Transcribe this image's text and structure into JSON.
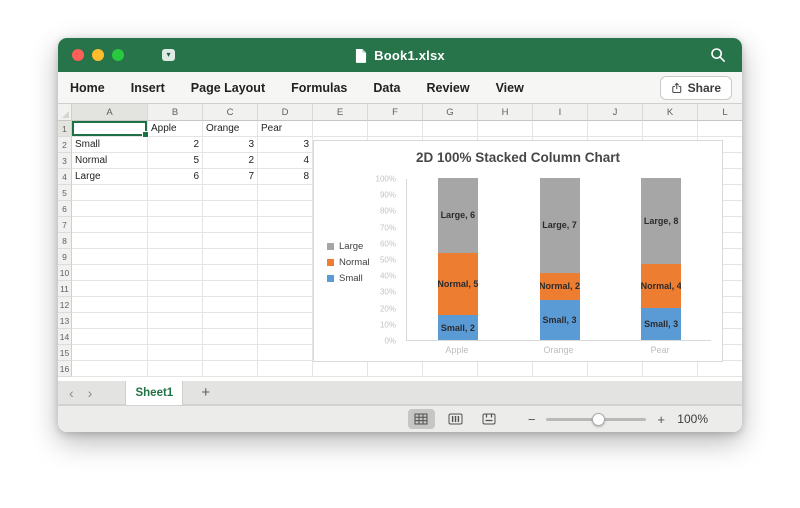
{
  "window": {
    "title": "Book1.xlsx",
    "controls": {
      "close": "close",
      "minimize": "minimize",
      "zoom": "zoom"
    }
  },
  "ribbon": {
    "tabs": [
      "Home",
      "Insert",
      "Page Layout",
      "Formulas",
      "Data",
      "Review",
      "View"
    ],
    "share_label": "Share"
  },
  "spreadsheet": {
    "columns": [
      "A",
      "B",
      "C",
      "D",
      "E",
      "F",
      "G",
      "H",
      "I",
      "J",
      "K",
      "L"
    ],
    "row_count": 16,
    "selected_cell": "A1",
    "data_rows": [
      [
        "",
        "Apple",
        "Orange",
        "Pear"
      ],
      [
        "Small",
        2,
        3,
        3
      ],
      [
        "Normal",
        5,
        2,
        4
      ],
      [
        "Large",
        6,
        7,
        8
      ]
    ]
  },
  "chart_data": {
    "type": "bar",
    "subtype": "100%-stacked-column",
    "title": "2D 100% Stacked Column Chart",
    "categories": [
      "Apple",
      "Orange",
      "Pear"
    ],
    "series": [
      {
        "name": "Small",
        "color": "#5b9bd5",
        "values": [
          2,
          3,
          3
        ]
      },
      {
        "name": "Normal",
        "color": "#ed7d31",
        "values": [
          5,
          2,
          4
        ]
      },
      {
        "name": "Large",
        "color": "#a6a6a6",
        "values": [
          6,
          7,
          8
        ]
      }
    ],
    "legend_order": [
      "Large",
      "Normal",
      "Small"
    ],
    "legend_position": "left",
    "y_ticks": [
      "100%",
      "90%",
      "80%",
      "70%",
      "60%",
      "50%",
      "40%",
      "30%",
      "20%",
      "10%",
      "0%"
    ],
    "ylim": [
      0,
      1
    ],
    "grid": false,
    "data_label_format": "{series}, {value}"
  },
  "sheet_bar": {
    "prev_icon": "‹",
    "next_icon": "›",
    "tabs": [
      {
        "label": "Sheet1",
        "active": true
      }
    ],
    "add_label": "+"
  },
  "status_bar": {
    "views": [
      "normal",
      "page-layout",
      "page-break"
    ],
    "active_view": "normal",
    "zoom_out_label": "−",
    "zoom_in_label": "+",
    "zoom_label": "100%",
    "zoom_percent": 100
  },
  "colors": {
    "excel_green": "#27744a",
    "selection_green": "#1e7145",
    "traffic_red": "#ff5f57",
    "traffic_yellow": "#febc2e",
    "traffic_green": "#28c840"
  }
}
